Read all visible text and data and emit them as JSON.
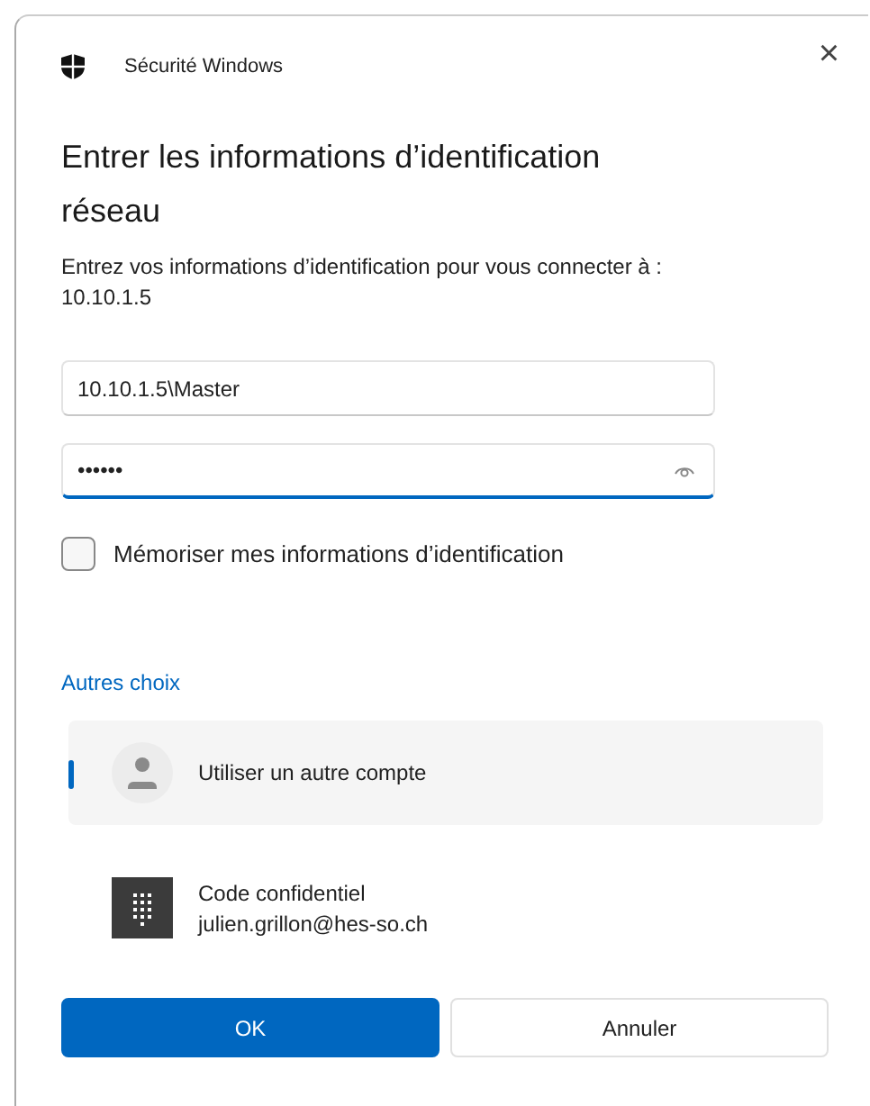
{
  "window": {
    "title": "Sécurité Windows",
    "close": "×"
  },
  "heading": "Entrer les informations d’identification réseau",
  "description": "Entrez vos informations d’identification pour vous connecter à : 10.10.1.5",
  "username": {
    "value": "10.10.1.5\\Master"
  },
  "password": {
    "value": "••••••",
    "focused": true
  },
  "remember": {
    "label": "Mémoriser mes informations d’identification",
    "checked": false
  },
  "other_choices": {
    "title": "Autres choix",
    "options": [
      {
        "kind": "account",
        "label": "Utiliser un autre compte",
        "selected": true
      },
      {
        "kind": "pin",
        "label": "Code confidentiel",
        "sublabel": "julien.grillon@hes-so.ch",
        "selected": false
      }
    ]
  },
  "buttons": [
    {
      "label": "OK",
      "kind": "primary"
    },
    {
      "label": "Annuler",
      "kind": "secondary"
    }
  ]
}
